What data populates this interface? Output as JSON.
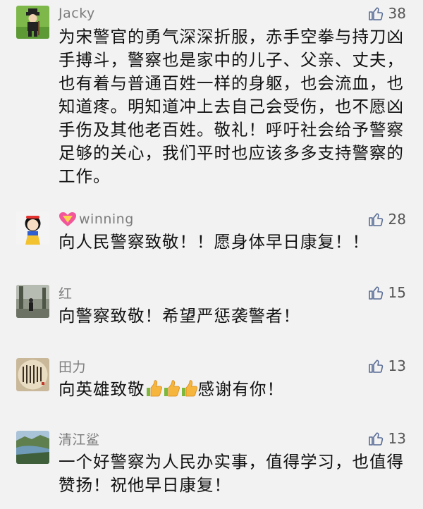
{
  "comments": [
    {
      "name": "Jacky",
      "likes": "38",
      "text": "为宋警官的勇气深深折服，赤手空拳与持刀凶手搏斗，警察也是家中的儿子、父亲、丈夫，也有着与普通百姓一样的身躯，也会流血，也知道疼。明知道冲上去自己会受伤，也不愿凶手伤及其他老百姓。敬礼！呼吁社会给予警察足够的关心，我们平时也应该多多支持警察的工作。"
    },
    {
      "name": "winning",
      "likes": "28",
      "text": "向人民警察致敬！！愿身体早日康复！！"
    },
    {
      "name": "红",
      "likes": "15",
      "text": "向警察致敬！希望严惩袭警者！"
    },
    {
      "name": "田力",
      "likes": "13",
      "text_before": "向英雄致敬",
      "text_after": "感谢有你！"
    },
    {
      "name": "清江鲨",
      "likes": "13",
      "text": "一个好警察为人民办实事，值得学习，也值得赞扬！祝他早日康复！"
    }
  ],
  "icons": {
    "like": "thumbs-up-outline-icon",
    "emoji": "thumbs-up-emoji-icon",
    "name_prefix": "heart-emoji-icon"
  },
  "colors": {
    "background": "#f2f2f2",
    "name": "#7c7c7c",
    "text": "#111111",
    "like_icon": "#576b95"
  }
}
